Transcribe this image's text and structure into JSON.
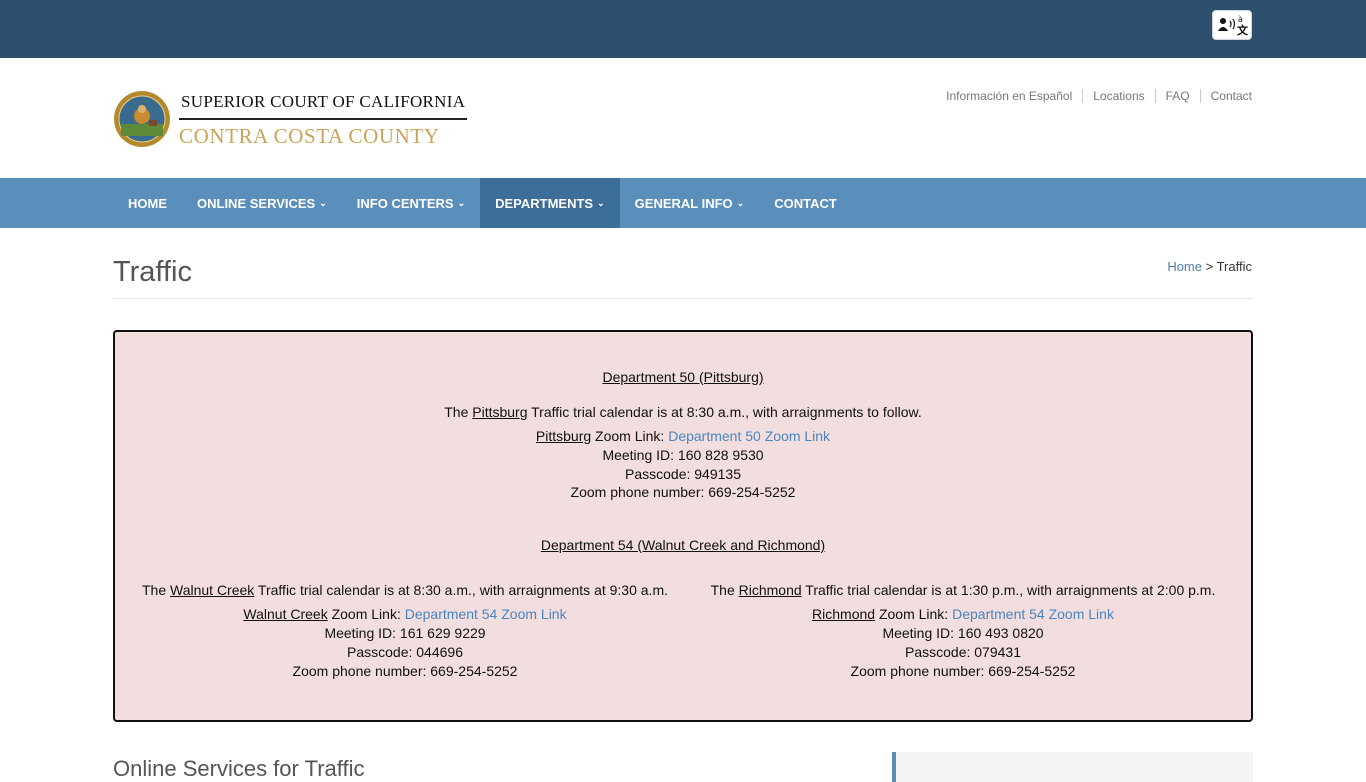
{
  "topbar": {
    "translate_icon": "translate-icon"
  },
  "logo": {
    "line1": "SUPERIOR COURT OF CALIFORNIA",
    "line2": "CONTRA COSTA COUNTY"
  },
  "util_links": [
    "Información en Español",
    "Locations",
    "FAQ",
    "Contact"
  ],
  "nav": [
    {
      "label": "HOME",
      "caret": false
    },
    {
      "label": "ONLINE SERVICES",
      "caret": true
    },
    {
      "label": "INFO CENTERS",
      "caret": true
    },
    {
      "label": "DEPARTMENTS",
      "caret": true,
      "active": true
    },
    {
      "label": "GENERAL INFO",
      "caret": true
    },
    {
      "label": "CONTACT",
      "caret": false
    }
  ],
  "page": {
    "title": "Traffic",
    "breadcrumb_home": "Home",
    "breadcrumb_sep": " > ",
    "breadcrumb_current": "Traffic"
  },
  "notice": {
    "dept50": {
      "heading": "Department 50 (Pittsburg)",
      "calendar_pre": "The ",
      "calendar_city": "Pittsburg",
      "calendar_post": " Traffic trial calendar is at 8:30 a.m., with arraignments to follow.",
      "zoom_city": "Pittsburg",
      "zoom_label": " Zoom Link: ",
      "zoom_link": "Department 50 Zoom Link",
      "meeting_id": "Meeting ID: 160 828 9530",
      "passcode": "Passcode: 949135",
      "phone": "Zoom phone number: 669-254-5252"
    },
    "dept54": {
      "heading": "Department 54 (Walnut Creek and Richmond)",
      "walnut": {
        "calendar_pre": "The ",
        "calendar_city": "Walnut Creek",
        "calendar_post": " Traffic trial calendar is at 8:30 a.m., with arraignments at 9:30 a.m.",
        "zoom_city": "Walnut Creek",
        "zoom_label": " Zoom Link: ",
        "zoom_link": "Department 54 Zoom Link",
        "meeting_id": "Meeting ID: 161 629 9229",
        "passcode": "Passcode: 044696",
        "phone": "Zoom phone number: 669-254-5252"
      },
      "richmond": {
        "calendar_pre": "The ",
        "calendar_city": "Richmond",
        "calendar_post": " Traffic trial calendar is at 1:30 p.m., with arraignments at 2:00 p.m.",
        "zoom_city": "Richmond",
        "zoom_label": " Zoom Link: ",
        "zoom_link": "Department 54 Zoom Link",
        "meeting_id": "Meeting ID: 160 493 0820",
        "passcode": "Passcode: 079431",
        "phone": "Zoom phone number: 669-254-5252"
      }
    }
  },
  "section": {
    "heading": "Online Services for Traffic"
  },
  "colors": {
    "topbar": "#2e4f6e",
    "nav": "#5b8fbb",
    "nav_active": "#3d6d99",
    "notice_bg": "#f2dede",
    "link": "#4a86c0",
    "gold": "#c9a45a"
  }
}
